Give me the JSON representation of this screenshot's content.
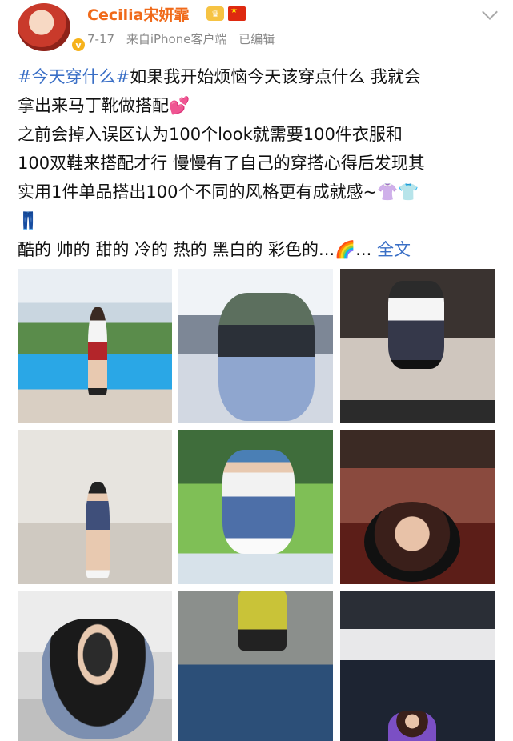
{
  "post": {
    "user_name": "Cecilia宋妍霏",
    "avatar_badge": "v",
    "date": "7-17",
    "source": "来自iPhone客户端",
    "edited": "已编辑",
    "hashtag": "#今天穿什么#",
    "line1": "如果我开始烦恼今天该穿点什么 我就会",
    "line2": "拿出来马丁靴做搭配",
    "line3": "之前会掉入误区认为100个look就需要100件衣服和",
    "line4": "100双鞋来搭配才行 慢慢有了自己的穿搭心得后发现其",
    "line5": "实用1件单品搭出100个不同的风格更有成就感~",
    "line6": "酷的 帅的 甜的 冷的 热的 黑白的 彩色的...",
    "ellipsis": "...",
    "full_text_link": "全文",
    "icons": [
      "vip-icon",
      "china-flag-icon",
      "chevron-down-icon",
      "heart-emoji",
      "tshirt-emoji",
      "jeans-emoji",
      "rainbow-emoji"
    ]
  },
  "photos": [
    "photo-1",
    "photo-2",
    "photo-3",
    "photo-4",
    "photo-5",
    "photo-6",
    "photo-7",
    "photo-8",
    "photo-9"
  ]
}
